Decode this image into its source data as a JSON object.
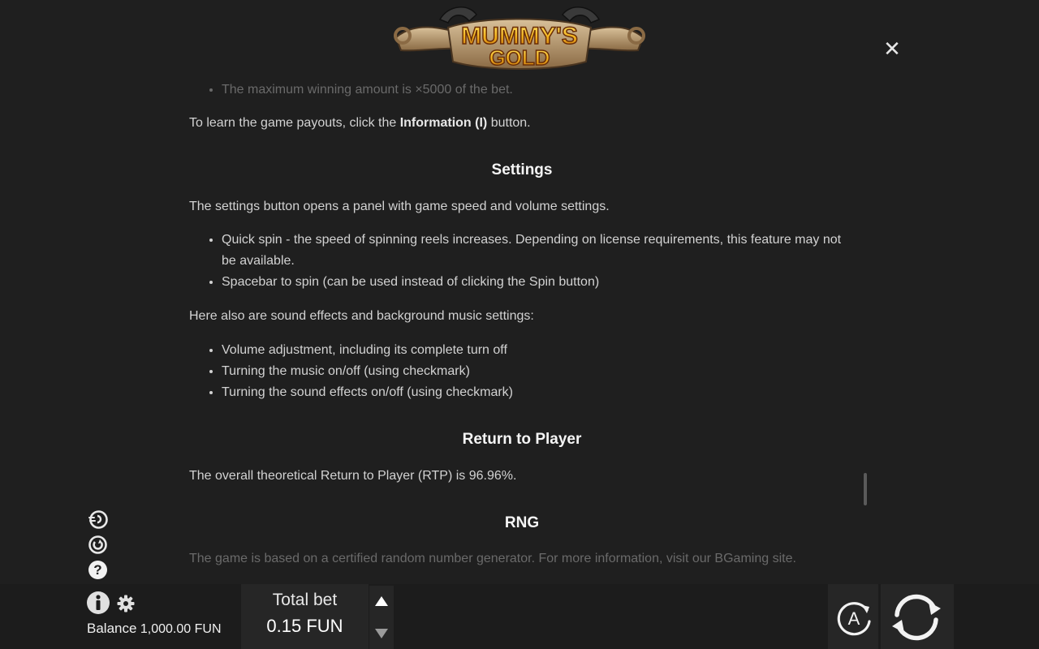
{
  "logo": {
    "line1": "MUMMY'S",
    "line2": "GOLD"
  },
  "rules": {
    "partial_bullet": "The maximum winning amount is ×5000 of the bet.",
    "payouts_text_before": "To learn the game payouts, click the ",
    "payouts_text_bold": "Information (I)",
    "payouts_text_after": " button.",
    "settings_heading": "Settings",
    "settings_intro": "The settings button opens a panel with game speed and volume settings.",
    "settings_items": [
      "Quick spin - the speed of spinning reels increases. Depending on license requirements, this feature may not be available.",
      "Spacebar to spin (can be used instead of clicking the Spin button)"
    ],
    "sound_intro": "Here also are sound effects and background music settings:",
    "sound_items": [
      "Volume adjustment, including its complete turn off",
      "Turning the music on/off (using checkmark)",
      "Turning the sound effects on/off (using checkmark)"
    ],
    "rtp_heading": "Return to Player",
    "rtp_text": "The overall theoretical Return to Player (RTP) is 96.96%.",
    "rng_heading": "RNG",
    "rng_text": "The game is based on a certified random number generator. For more information, visit our BGaming site."
  },
  "bottom": {
    "balance_label": "Balance",
    "balance_value": "1,000.00 FUN",
    "total_bet_label": "Total bet",
    "total_bet_value": "0.15 FUN",
    "auto_label": "A"
  },
  "close_glyph": "✕",
  "colors": {
    "background": "#1f1f1f",
    "text": "#d2d2d2",
    "heading": "#f5f5f5",
    "logo_gold": "#f2c21c",
    "panel": "#262626"
  }
}
